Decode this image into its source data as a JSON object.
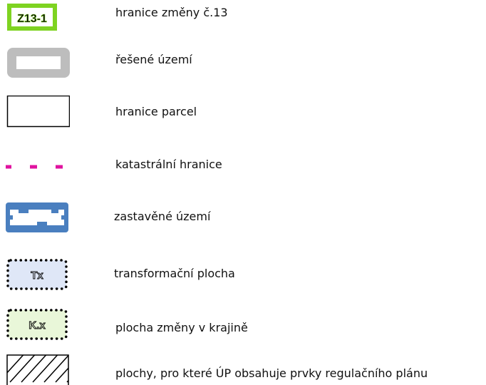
{
  "legend": {
    "items": [
      {
        "label": "hranice změny č.13",
        "symbol_text": "Z13-1",
        "symbol": "green-outlined-label-box",
        "color": "#7ed321"
      },
      {
        "label": "řešené území",
        "symbol": "gray-thick-frame",
        "color": "#bdbdbd"
      },
      {
        "label": "hranice parcel",
        "symbol": "black-thin-rectangle",
        "color": "#000000"
      },
      {
        "label": "katastrální hranice",
        "symbol": "magenta-dashed-line",
        "color": "#e0139f"
      },
      {
        "label": "zastavěné území",
        "symbol": "blue-frame-with-notches",
        "color": "#4a7fbf"
      },
      {
        "label": "transformační plocha",
        "symbol_text": "Tx",
        "symbol": "dotted-blue-box",
        "color": "#dfe7f7"
      },
      {
        "label": "plocha změny v krajině",
        "symbol_text": "K.x",
        "symbol": "dotted-green-box",
        "color": "#e9f7d9"
      },
      {
        "label": "plochy, pro které ÚP obsahuje prvky regulačního plánu",
        "symbol": "hatched-rectangle",
        "color": "#000000"
      }
    ]
  }
}
